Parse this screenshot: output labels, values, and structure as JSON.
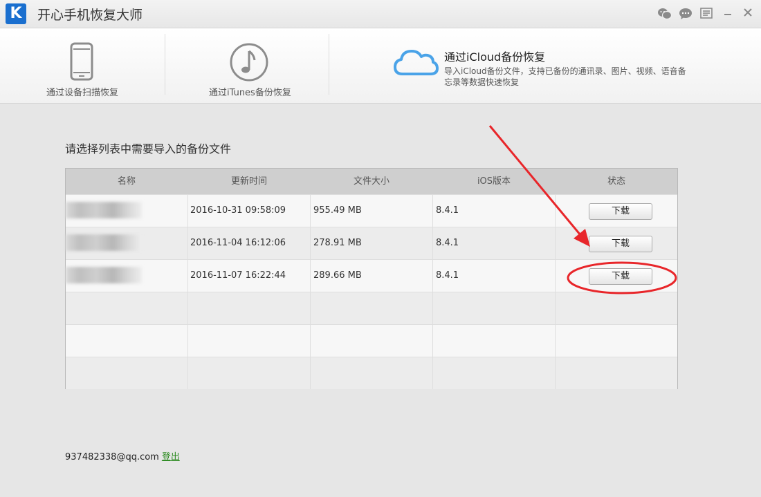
{
  "window": {
    "logo_letter": "K",
    "title": "开心手机恢复大师",
    "controls": [
      "wechat-icon",
      "chat-icon",
      "menu-icon",
      "minimize-icon",
      "close-icon"
    ]
  },
  "nav": {
    "tabs": [
      {
        "label": "通过设备扫描恢复",
        "icon": "phone-icon"
      },
      {
        "label": "通过iTunes备份恢复",
        "icon": "music-note-icon"
      },
      {
        "label": "通过iCloud备份恢复",
        "icon": "cloud-icon",
        "active": true,
        "description": "导入iCloud备份文件，支持已备份的通讯录、图片、视频、语音备忘录等数据快速恢复"
      }
    ]
  },
  "main": {
    "heading": "请选择列表中需要导入的备份文件",
    "table": {
      "headers": [
        "名称",
        "更新时间",
        "文件大小",
        "iOS版本",
        "状态"
      ],
      "rows": [
        {
          "name": "",
          "updated": "2016-10-31 09:58:09",
          "size": "955.49 MB",
          "ios": "8.4.1",
          "action": "下载"
        },
        {
          "name": "",
          "updated": "2016-11-04 16:12:06",
          "size": "278.91 MB",
          "ios": "8.4.1",
          "action": "下载"
        },
        {
          "name": "",
          "updated": "2016-11-07 16:22:44",
          "size": "289.66 MB",
          "ios": "8.4.1",
          "action": "下载"
        }
      ]
    }
  },
  "footer": {
    "account": "937482338@qq.com",
    "logout_label": "登出"
  },
  "colors": {
    "accent_blue": "#1a6fcf",
    "cloud_blue": "#4aa3e8",
    "annotation_red": "#e8262a",
    "logout_green": "#2a8a1f"
  }
}
